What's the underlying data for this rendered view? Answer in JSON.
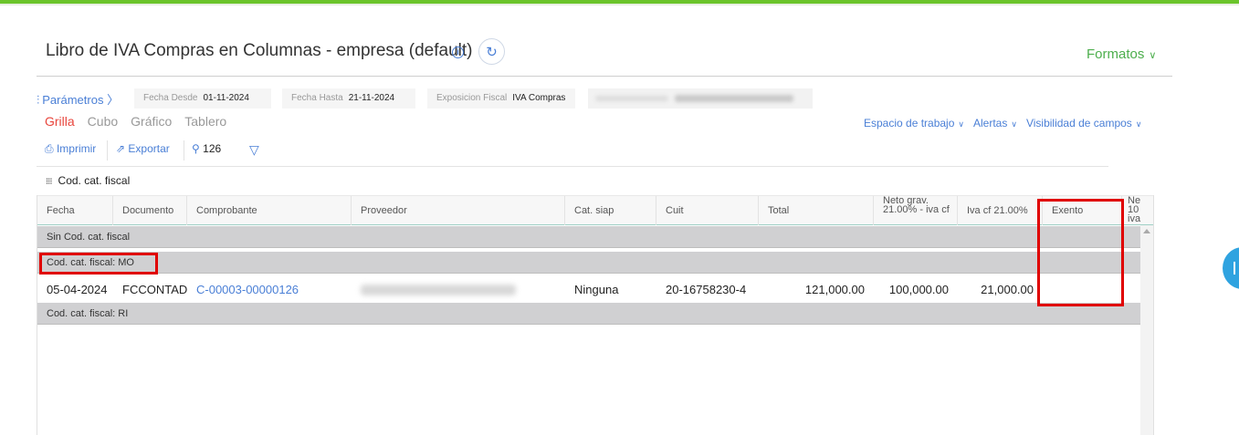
{
  "page": {
    "title": "Libro de IVA Compras en Columnas - empresa (default)",
    "info_icon": "info-icon",
    "refresh_icon": "refresh-icon",
    "formats_label": "Formatos"
  },
  "params": {
    "label": "Parámetros",
    "filters": [
      {
        "label": "Fecha Desde",
        "value": "01-11-2024"
      },
      {
        "label": "Fecha Hasta",
        "value": "21-11-2024"
      },
      {
        "label": "Exposicion Fiscal",
        "value": "IVA Compras"
      }
    ]
  },
  "views": {
    "items": [
      "Grilla",
      "Cubo",
      "Gráfico",
      "Tablero"
    ],
    "active": "Grilla"
  },
  "workspace_links": [
    "Espacio de trabajo",
    "Alertas",
    "Visibilidad de campos"
  ],
  "toolbar": {
    "print_label": "Imprimir",
    "export_label": "Exportar",
    "count": "126"
  },
  "group_by": {
    "label": "Cod. cat. fiscal"
  },
  "grid": {
    "columns": [
      "Fecha",
      "Documento",
      "Comprobante",
      "Proveedor",
      "Cat. siap",
      "Cuit",
      "Total",
      "Neto grav. 21.00% - iva cf",
      "Iva cf 21.00%",
      "Exento",
      "Ne 10 iva"
    ],
    "groups": [
      {
        "label": "Sin Cod. cat. fiscal"
      },
      {
        "label": "Cod. cat. fiscal: MO"
      },
      {
        "label": "Cod. cat. fiscal: RI"
      }
    ],
    "row": {
      "fecha": "05-04-2024",
      "documento": "FCCONTADO",
      "comprobante": "C-00003-00000126",
      "cat_siap": "Ninguna",
      "cuit": "20-16758230-4",
      "total": "121,000.00",
      "neto": "100,000.00",
      "iva": "21,000.00",
      "exento": ""
    }
  },
  "colors": {
    "accent": "#4a7fd6",
    "brand_green": "#6bc42b",
    "active_tab": "#e8453c",
    "highlight": "#e00000"
  }
}
